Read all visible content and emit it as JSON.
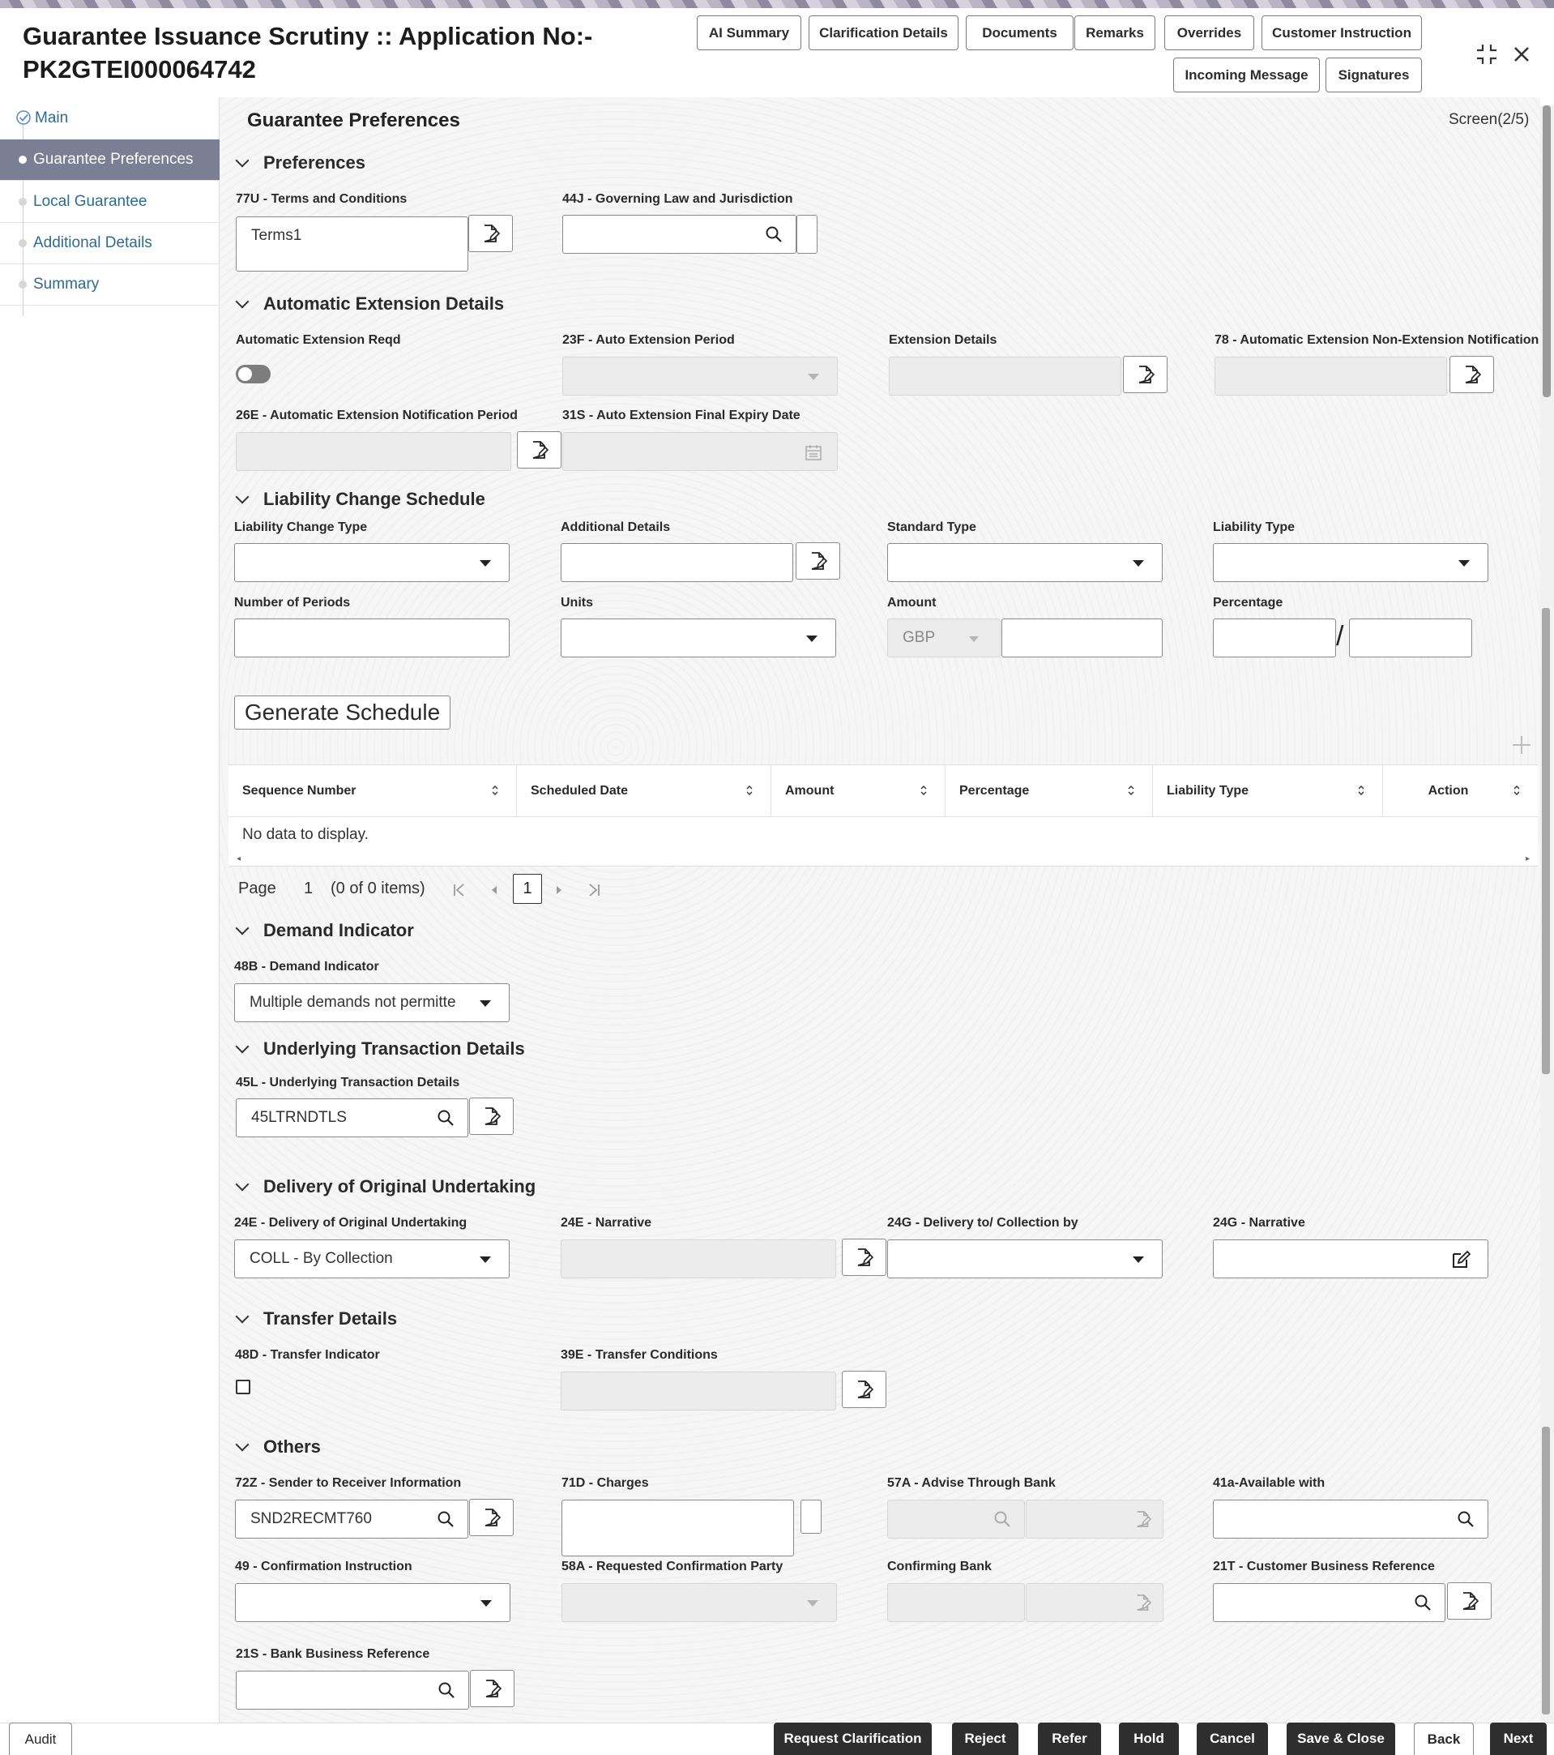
{
  "header": {
    "title_line1": "Guarantee Issuance Scrutiny :: Application No:-",
    "title_line2": "PK2GTEI000064742",
    "buttons": {
      "ai_summary": "AI Summary",
      "clarification_details": "Clarification Details",
      "documents": "Documents",
      "remarks": "Remarks",
      "overrides": "Overrides",
      "customer_instruction": "Customer Instruction",
      "incoming_message": "Incoming Message",
      "signatures": "Signatures"
    }
  },
  "sidebar": {
    "items": [
      {
        "label": "Main"
      },
      {
        "label": "Guarantee Preferences"
      },
      {
        "label": "Local Guarantee"
      },
      {
        "label": "Additional Details"
      },
      {
        "label": "Summary"
      }
    ]
  },
  "page": {
    "title": "Guarantee Preferences",
    "screen": "Screen(2/5)"
  },
  "preferences": {
    "heading": "Preferences",
    "terms_label": "77U - Terms and Conditions",
    "terms_value": "Terms1",
    "governing_label": "44J - Governing Law and Jurisdiction",
    "governing_value": ""
  },
  "auto_ext": {
    "heading": "Automatic Extension Details",
    "reqd_label": "Automatic Extension Reqd",
    "period_label": "23F - Auto Extension Period",
    "details_label": "Extension Details",
    "nonext_label": "78 - Automatic Extension Non-Extension Notification",
    "notif_label": "26E - Automatic Extension Notification Period",
    "final_expiry_label": "31S - Auto Extension Final Expiry Date"
  },
  "liability": {
    "heading": "Liability Change Schedule",
    "change_type_label": "Liability Change Type",
    "additional_label": "Additional Details",
    "standard_label": "Standard Type",
    "liability_type_label": "Liability Type",
    "periods_label": "Number of Periods",
    "units_label": "Units",
    "amount_label": "Amount",
    "currency": "GBP",
    "percentage_label": "Percentage",
    "slash": "/",
    "generate": "Generate Schedule"
  },
  "table": {
    "columns": [
      "Sequence Number",
      "Scheduled Date",
      "Amount",
      "Percentage",
      "Liability Type",
      "Action"
    ],
    "empty": "No data to display."
  },
  "pager": {
    "page_label": "Page",
    "page_num": "1",
    "items": "(0 of 0 items)",
    "current": "1"
  },
  "demand": {
    "heading": "Demand Indicator",
    "label": "48B - Demand Indicator",
    "value": "Multiple demands not permitte"
  },
  "underlying": {
    "heading": "Underlying Transaction Details",
    "label": "45L - Underlying Transaction Details",
    "value": "45LTRNDTLS"
  },
  "delivery": {
    "heading": "Delivery of Original Undertaking",
    "delivery_label": "24E - Delivery of Original Undertaking",
    "delivery_value": "COLL - By Collection",
    "narrative_label": "24E - Narrative",
    "to_label": "24G - Delivery to/ Collection by",
    "narrative2_label": "24G - Narrative"
  },
  "transfer": {
    "heading": "Transfer Details",
    "indicator_label": "48D - Transfer Indicator",
    "conditions_label": "39E - Transfer Conditions"
  },
  "others": {
    "heading": "Others",
    "sender_label": "72Z - Sender to Receiver Information",
    "sender_value": "SND2RECMT760",
    "charges_label": "71D - Charges",
    "advise_label": "57A - Advise Through Bank",
    "available_label": "41a-Available with",
    "confirm_instr_label": "49 - Confirmation Instruction",
    "req_confirm_label": "58A - Requested Confirmation Party",
    "confirming_label": "Confirming Bank",
    "cust_ref_label": "21T - Customer Business Reference",
    "bank_ref_label": "21S - Bank Business Reference"
  },
  "footer": {
    "audit": "Audit",
    "request_clarification": "Request Clarification",
    "reject": "Reject",
    "refer": "Refer",
    "hold": "Hold",
    "cancel": "Cancel",
    "save_close": "Save & Close",
    "back": "Back",
    "next": "Next"
  }
}
